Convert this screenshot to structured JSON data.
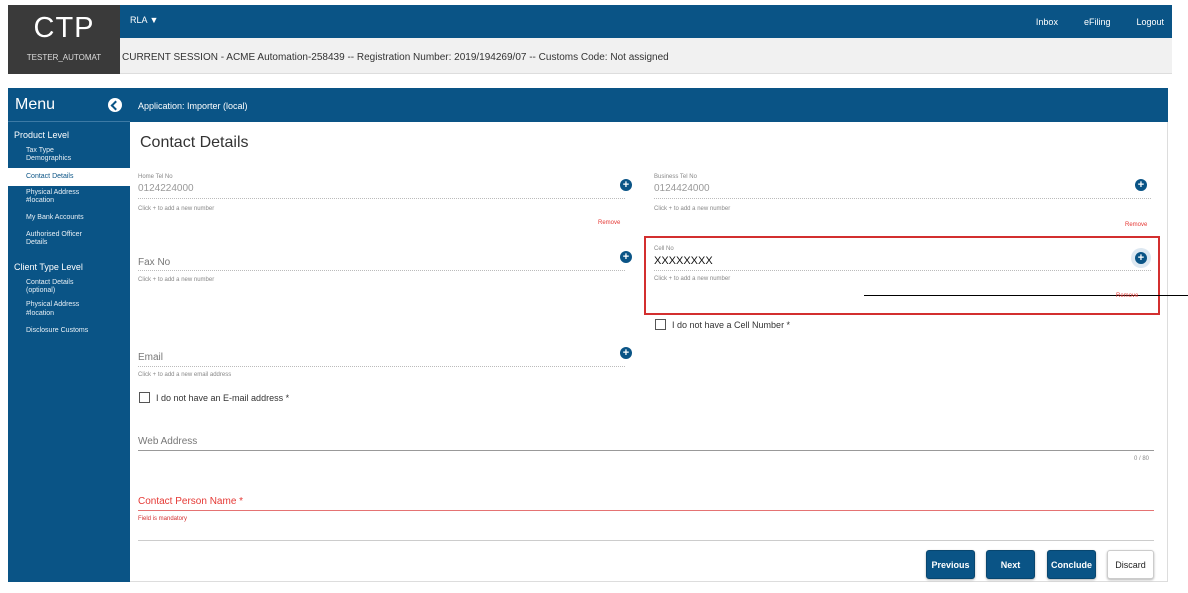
{
  "brand": {
    "logo": "CTP",
    "user": "TESTER_AUTOMAT"
  },
  "topbar": {
    "app_menu": "RLA ▼",
    "links": [
      "Inbox",
      "eFiling",
      "Logout"
    ]
  },
  "session": {
    "text": "CURRENT SESSION - ACME Automation-258439 -- Registration Number: 2019/194269/07 -- Customs Code: Not assigned"
  },
  "sidebar": {
    "title": "Menu",
    "product_level": "Product Level",
    "product_items": [
      "Tax Type Demographics",
      "Contact Details",
      "Physical Address #location",
      "My Bank Accounts",
      "Authorised Officer Details"
    ],
    "client_level": "Client Type Level",
    "client_items": [
      "Contact Details (optional)",
      "Physical Address #location",
      "Disclosure Customs"
    ]
  },
  "app_header": "Application: Importer (local)",
  "form": {
    "title": "Contact Details",
    "home_tel": {
      "label": "Home Tel No",
      "value": "0124224000",
      "hint": "Click + to add a new number",
      "remove": "Remove"
    },
    "business_tel": {
      "label": "Business Tel No",
      "value": "0124424000",
      "hint": "Click + to add a new number",
      "remove": "Remove"
    },
    "fax": {
      "placeholder": "Fax No",
      "hint": "Click + to add a new number"
    },
    "cell": {
      "label": "Cell No",
      "value": "XXXXXXXX",
      "hint": "Click + to add a new number",
      "remove": "Remove",
      "no_cell": "I do not have a Cell Number *"
    },
    "email": {
      "placeholder": "Email",
      "hint": "Click + to add a new email address",
      "no_email": "I do not have an E-mail address *"
    },
    "web": {
      "placeholder": "Web Address",
      "counter": "0 / 80"
    },
    "contact_person": {
      "placeholder": "Contact Person Name *",
      "error": "Field is mandatory"
    },
    "plus_icon": "+"
  },
  "buttons": {
    "previous": "Previous",
    "next": "Next",
    "conclude": "Conclude",
    "discard": "Discard"
  },
  "colors": {
    "primary": "#0a5486",
    "error": "#e53935",
    "dark": "#3a3a3a"
  }
}
